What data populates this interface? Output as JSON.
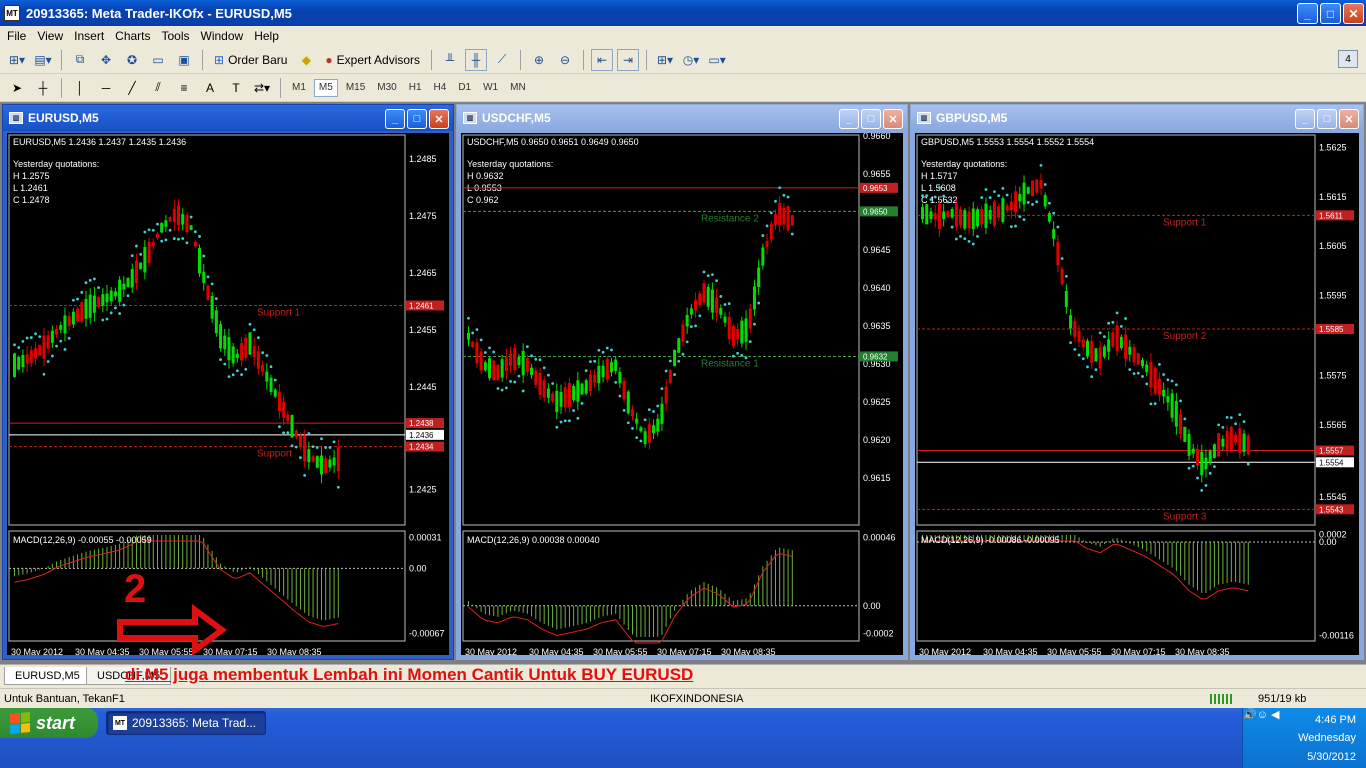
{
  "app": {
    "title": "20913365: Meta Trader-IKOfx - EURUSD,M5"
  },
  "menu": [
    "File",
    "View",
    "Insert",
    "Charts",
    "Tools",
    "Window",
    "Help"
  ],
  "toolbar": {
    "order_label": "Order Baru",
    "expert_label": "Expert Advisors",
    "badge": "4"
  },
  "timeframes": [
    "M1",
    "M5",
    "M15",
    "M30",
    "H1",
    "H4",
    "D1",
    "W1",
    "MN"
  ],
  "charts": [
    {
      "title": "EURUSD,M5",
      "header": "EURUSD,M5  1.2436 1.2437 1.2435 1.2436",
      "yq_title": "Yesterday quotations:",
      "yq_h": "H 1.2575",
      "yq_l": "L 1.2461",
      "yq_c": "C 1.2478",
      "price_labels": [
        "1.2485",
        "1.2475",
        "1.2465",
        "1.2455",
        "1.2445",
        "1.2425"
      ],
      "tag_top": "1.2461",
      "tag_mid": "1.2438",
      "tag_cur": "1.2436",
      "tag_low": "1.2434",
      "support1": "Support 1",
      "support2": "Support",
      "macd_label": "MACD(12,26,9) -0.00055 -0.00059",
      "macd_axis": [
        "0.00031",
        "0.00",
        "-0.00067"
      ],
      "time_labels": [
        "30 May 2012",
        "30 May 04:35",
        "30 May 05:55",
        "30 May 07:15",
        "30 May 08:35"
      ]
    },
    {
      "title": "USDCHF,M5",
      "header": "USDCHF,M5  0.9650 0.9651 0.9649 0.9650",
      "yq_title": "Yesterday quotations:",
      "yq_h": "H 0.9632",
      "yq_l": "L 0.9553",
      "yq_c": "C 0.962",
      "price_labels": [
        "0.9660",
        "0.9655",
        "0.9645",
        "0.9640",
        "0.9635",
        "0.9630",
        "0.9625",
        "0.9620",
        "0.9615"
      ],
      "tag_top": "0.9653",
      "tag_cur": "0.9650",
      "tag_res": "0.9632",
      "resistance2": "Resistance 2",
      "resistance1": "Resistance 1",
      "macd_label": "MACD(12,26,9) 0.00038 0.00040",
      "macd_axis": [
        "0.00046",
        "0.00",
        "-0.0002"
      ],
      "time_labels": [
        "30 May 2012",
        "30 May 04:35",
        "30 May 05:55",
        "30 May 07:15",
        "30 May 08:35"
      ]
    },
    {
      "title": "GBPUSD,M5",
      "header": "GBPUSD,M5  1.5553 1.5554 1.5552 1.5554",
      "yq_title": "Yesterday quotations:",
      "yq_h": "H 1.5717",
      "yq_l": "L 1.5608",
      "yq_c": "C 1.5632",
      "price_labels": [
        "1.5625",
        "1.5615",
        "1.5605",
        "1.5595",
        "1.5575",
        "1.5565",
        "1.5545"
      ],
      "tag_s1": "1.5611",
      "tag_s2": "1.5585",
      "tag_mid": "1.5557",
      "tag_cur": "1.5554",
      "tag_s3": "1.5543",
      "support1": "Support 1",
      "support2": "Support 2",
      "support3": "Support 3",
      "macd_label": "MACD(12,26,9) -0.00086 -0.00095",
      "macd_axis": [
        "0.0002",
        "0.00",
        "-0.00116"
      ],
      "time_labels": [
        "30 May 2012",
        "30 May 04:35",
        "30 May 05:55",
        "30 May 07:15",
        "30 May 08:35"
      ]
    }
  ],
  "annotation": {
    "number": "2",
    "caption": "di M5 juga membentuk Lembah ini Momen Cantik Untuk BUY EURUSD"
  },
  "tabs": [
    "EURUSD,M5",
    "USDCHF,M5"
  ],
  "status": {
    "help": "Untuk Bantuan, TekanF1",
    "server": "IKOFXINDONESIA",
    "traffic": "951/19 kb"
  },
  "taskbar": {
    "start": "start",
    "task": "20913365: Meta Trad...",
    "time": "4:46 PM",
    "day": "Wednesday",
    "date": "5/30/2012"
  },
  "colors": {
    "bull": "#00e000",
    "bear": "#e00000",
    "sar": "#40d0d0",
    "support": "#c02020",
    "resistance": "#208030"
  }
}
